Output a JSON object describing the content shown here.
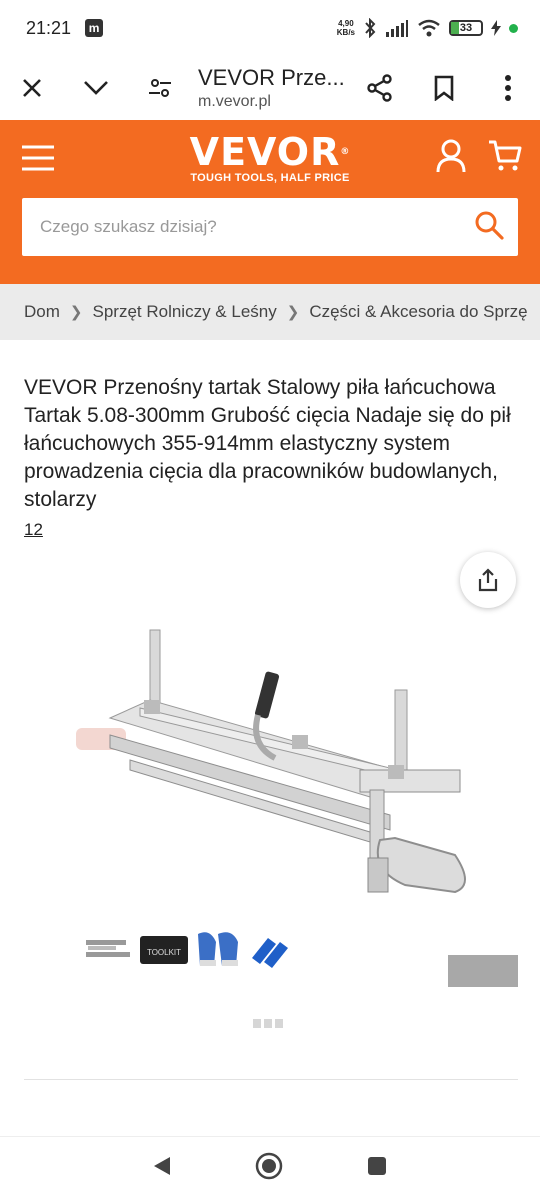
{
  "status_bar": {
    "time": "21:21",
    "app_badge": "m",
    "net_speed_value": "4,90",
    "net_speed_unit": "KB/s",
    "battery": "33"
  },
  "browser": {
    "page_title": "VEVOR Prze...",
    "url": "m.vevor.pl",
    "icons": [
      "close-icon",
      "chevron-down-icon",
      "tune-icon",
      "share-icon",
      "bookmark-icon",
      "more-vert-icon"
    ]
  },
  "header": {
    "logo": "VEVOR",
    "logo_mark": "®",
    "tagline": "TOUGH TOOLS, HALF PRICE",
    "brand_color": "#f36b21",
    "search_placeholder": "Czego szukasz dzisiaj?"
  },
  "breadcrumb": [
    "Dom",
    "Sprzęt Rolniczy & Leśny",
    "Części & Akcesoria do Sprzę"
  ],
  "product": {
    "title": "VEVOR Przenośny tartak Stalowy piła łańcuchowa Tartak 5.08-300mm Grubość cięcia Nadaje się do pił łańcuchowych 355-914mm elastyczny system prowadzenia cięcia dla pracowników budowlanych, stolarzy",
    "review_count": "12",
    "accessory_label": "TOOLKIT"
  },
  "nav": {
    "icons": [
      "back-icon",
      "home-icon",
      "recents-icon"
    ]
  }
}
